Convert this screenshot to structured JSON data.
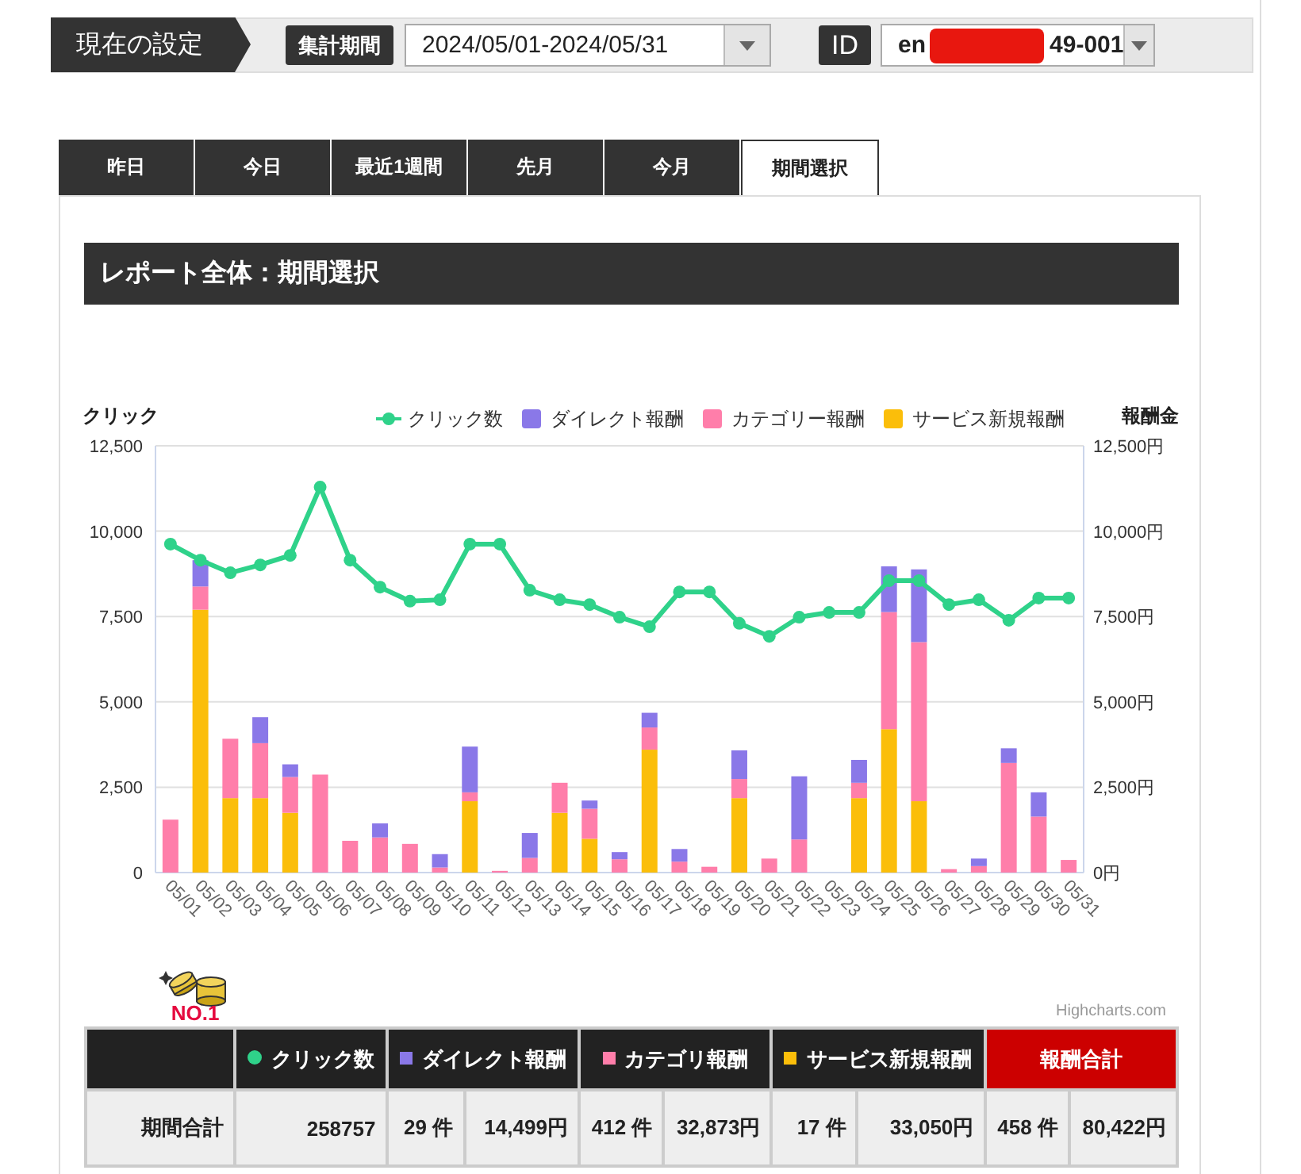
{
  "settings_bar": {
    "title": "現在の設定",
    "period_label": "集計期間",
    "period_value": "2024/05/01-2024/05/31",
    "id_label": "ID",
    "id_value_start": "en",
    "id_value_end": "49-001",
    "id_redacted": true
  },
  "tabs": [
    {
      "label": "昨日",
      "selected": false
    },
    {
      "label": "今日",
      "selected": false
    },
    {
      "label": "最近1週間",
      "selected": false
    },
    {
      "label": "先月",
      "selected": false
    },
    {
      "label": "今月",
      "selected": false
    },
    {
      "label": "期間選択",
      "selected": true
    }
  ],
  "report": {
    "title": "レポート全体：期間選択",
    "chart_data": {
      "type": "bar",
      "stacked": true,
      "ylabel": "クリック",
      "y2label": "報酬金",
      "categories": [
        "05/01",
        "05/02",
        "05/03",
        "05/04",
        "05/05",
        "05/06",
        "05/07",
        "05/08",
        "05/09",
        "05/10",
        "05/11",
        "05/12",
        "05/13",
        "05/14",
        "05/15",
        "05/16",
        "05/17",
        "05/18",
        "05/19",
        "05/20",
        "05/21",
        "05/22",
        "05/23",
        "05/24",
        "05/25",
        "05/26",
        "05/27",
        "05/28",
        "05/29",
        "05/30",
        "05/31"
      ],
      "ylim": [
        0,
        12500
      ],
      "y2lim": [
        0,
        12500
      ],
      "grid": true,
      "legend": "top",
      "yticks": [
        0,
        {
          "value": 2500,
          "label": "2,500"
        },
        {
          "value": 5000,
          "label": "5,000"
        },
        {
          "value": 7500,
          "label": "7,500"
        },
        {
          "value": 10000,
          "label": "10,000"
        },
        {
          "value": 12500,
          "label": "12,500"
        }
      ],
      "y2ticks": [
        {
          "value": 0,
          "label": "0円"
        },
        {
          "value": 2500,
          "label": "2,500円"
        },
        {
          "value": 5000,
          "label": "5,000円"
        },
        {
          "value": 7500,
          "label": "7,500円"
        },
        {
          "value": 10000,
          "label": "10,000円"
        },
        {
          "value": 12500,
          "label": "12,500円"
        }
      ],
      "series": [
        {
          "name": "クリック数",
          "type": "line",
          "marker": true,
          "color": "#2fd28a",
          "values": [
            9620,
            9150,
            8780,
            9010,
            9290,
            11290,
            9150,
            8360,
            7950,
            7990,
            9620,
            9620,
            8270,
            7990,
            7850,
            7480,
            7200,
            8220,
            8220,
            7300,
            6920,
            7480,
            7620,
            7620,
            8550,
            8550,
            7850,
            7990,
            7390,
            8040,
            8040
          ]
        },
        {
          "name": "ダイレクト報酬",
          "type": "bar",
          "color": "#8a78e8",
          "values": [
            0,
            770,
            0,
            760,
            370,
            0,
            0,
            410,
            0,
            390,
            1340,
            0,
            730,
            0,
            240,
            210,
            430,
            370,
            0,
            840,
            0,
            1850,
            0,
            670,
            1340,
            2130,
            0,
            220,
            430,
            710,
            0
          ]
        },
        {
          "name": "カテゴリー報酬",
          "type": "bar",
          "color": "#ff7eaa",
          "values": [
            1550,
            680,
            1740,
            1610,
            1050,
            2870,
            930,
            1030,
            840,
            150,
            260,
            50,
            430,
            880,
            880,
            390,
            650,
            320,
            170,
            560,
            410,
            970,
            0,
            450,
            3430,
            4660,
            100,
            190,
            3210,
            1640,
            370
          ]
        },
        {
          "name": "サービス新規報酬",
          "type": "bar",
          "color": "#fbbe0a",
          "values": [
            0,
            7700,
            2180,
            2180,
            1750,
            0,
            0,
            0,
            0,
            0,
            2090,
            0,
            0,
            1750,
            990,
            0,
            3600,
            0,
            0,
            2180,
            0,
            0,
            0,
            2180,
            4200,
            2090,
            0,
            0,
            0,
            0,
            0
          ]
        }
      ]
    },
    "badge_text": "NO.1",
    "credits": "Highcharts.com"
  },
  "summary_table": {
    "header_groups": [
      {
        "kind": "blank"
      },
      {
        "label": "クリック数",
        "kind": "dot",
        "color": "#2fd28a"
      },
      {
        "label": "ダイレクト報酬",
        "kind": "square",
        "color": "#8a78e8"
      },
      {
        "label": "カテゴリ報酬",
        "kind": "square",
        "color": "#ff7eaa"
      },
      {
        "label": "サービス新規報酬",
        "kind": "square",
        "color": "#fbbe0a"
      },
      {
        "label": "報酬合計",
        "kind": "total"
      }
    ],
    "body_rows": [
      {
        "label": "期間合計",
        "values": [
          "258757",
          "29 件",
          "14,499円",
          "412 件",
          "32,873円",
          "17 件",
          "33,050円",
          "458 件",
          "80,422円"
        ]
      }
    ]
  }
}
